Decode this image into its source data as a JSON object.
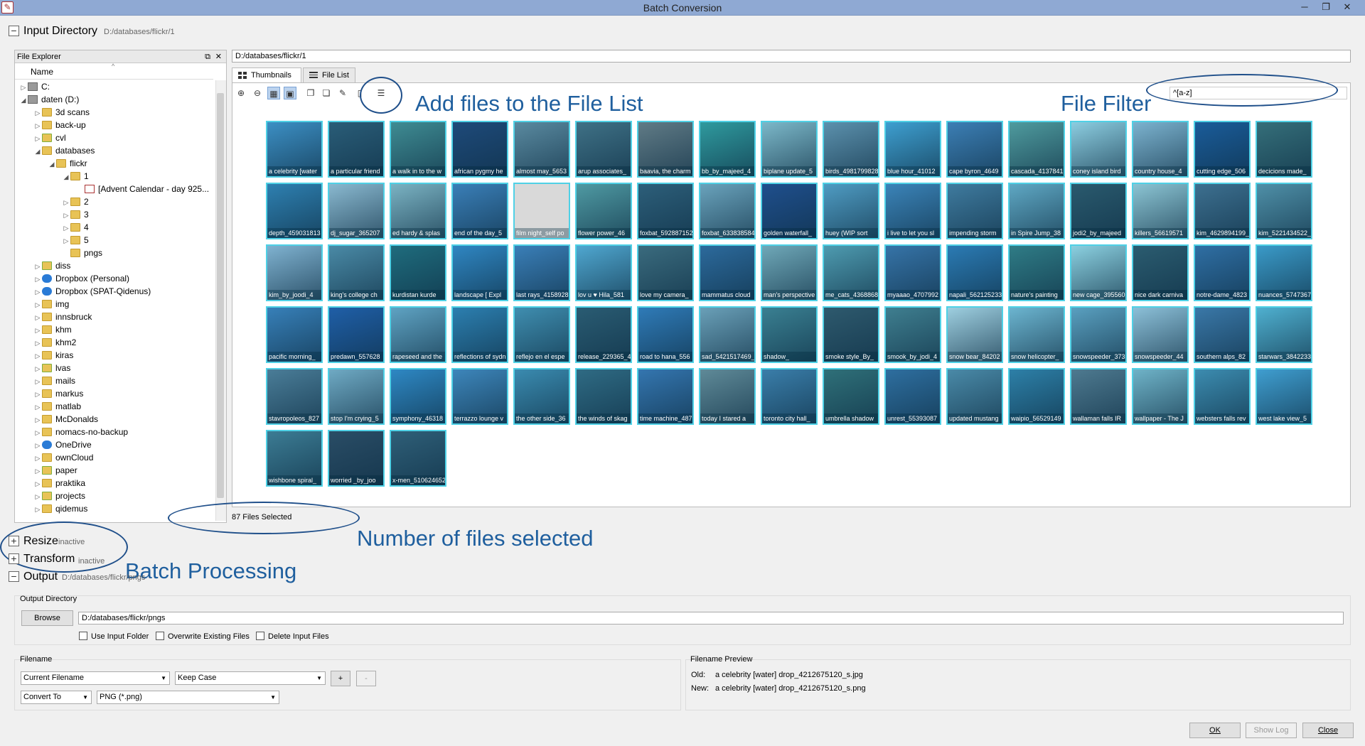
{
  "window": {
    "title": "Batch Conversion",
    "icon": "app-icon"
  },
  "input": {
    "heading": "Input Directory",
    "path": "D:/databases/flickr/1",
    "path_field": "D:/databases/flickr/1"
  },
  "explorer": {
    "title": "File Explorer",
    "column": "Name",
    "items": [
      {
        "label": "C:",
        "arrow": "▷",
        "icon": "drive",
        "depth": 0
      },
      {
        "label": "daten (D:)",
        "arrow": "◢",
        "icon": "drive",
        "depth": 0
      },
      {
        "label": "3d scans",
        "arrow": "▷",
        "icon": "folder",
        "depth": 1
      },
      {
        "label": "back-up",
        "arrow": "▷",
        "icon": "folder",
        "depth": 1
      },
      {
        "label": "cvl",
        "arrow": "▷",
        "icon": "folder-green",
        "depth": 1
      },
      {
        "label": "databases",
        "arrow": "◢",
        "icon": "folder",
        "depth": 1
      },
      {
        "label": "flickr",
        "arrow": "◢",
        "icon": "folder",
        "depth": 2
      },
      {
        "label": "1",
        "arrow": "◢",
        "icon": "folder",
        "depth": 3
      },
      {
        "label": "[Advent Calendar - day 925...",
        "arrow": "",
        "icon": "imgfile",
        "depth": 4
      },
      {
        "label": "2",
        "arrow": "▷",
        "icon": "folder",
        "depth": 3
      },
      {
        "label": "3",
        "arrow": "▷",
        "icon": "folder",
        "depth": 3
      },
      {
        "label": "4",
        "arrow": "▷",
        "icon": "folder",
        "depth": 3
      },
      {
        "label": "5",
        "arrow": "▷",
        "icon": "folder",
        "depth": 3
      },
      {
        "label": "pngs",
        "arrow": "",
        "icon": "folder",
        "depth": 3
      },
      {
        "label": "diss",
        "arrow": "▷",
        "icon": "folder-green",
        "depth": 1
      },
      {
        "label": "Dropbox (Personal)",
        "arrow": "▷",
        "icon": "cloud",
        "depth": 1
      },
      {
        "label": "Dropbox (SPAT-Qidenus)",
        "arrow": "▷",
        "icon": "cloud",
        "depth": 1
      },
      {
        "label": "img",
        "arrow": "▷",
        "icon": "folder",
        "depth": 1
      },
      {
        "label": "innsbruck",
        "arrow": "▷",
        "icon": "folder",
        "depth": 1
      },
      {
        "label": "khm",
        "arrow": "▷",
        "icon": "folder",
        "depth": 1
      },
      {
        "label": "khm2",
        "arrow": "▷",
        "icon": "folder",
        "depth": 1
      },
      {
        "label": "kiras",
        "arrow": "▷",
        "icon": "folder",
        "depth": 1
      },
      {
        "label": "lvas",
        "arrow": "▷",
        "icon": "folder-green",
        "depth": 1
      },
      {
        "label": "mails",
        "arrow": "▷",
        "icon": "folder",
        "depth": 1
      },
      {
        "label": "markus",
        "arrow": "▷",
        "icon": "folder",
        "depth": 1
      },
      {
        "label": "matlab",
        "arrow": "▷",
        "icon": "folder",
        "depth": 1
      },
      {
        "label": "McDonalds",
        "arrow": "▷",
        "icon": "folder",
        "depth": 1
      },
      {
        "label": "nomacs-no-backup",
        "arrow": "▷",
        "icon": "folder",
        "depth": 1
      },
      {
        "label": "OneDrive",
        "arrow": "▷",
        "icon": "cloud",
        "depth": 1
      },
      {
        "label": "ownCloud",
        "arrow": "▷",
        "icon": "folder",
        "depth": 1
      },
      {
        "label": "paper",
        "arrow": "▷",
        "icon": "folder-green",
        "depth": 1
      },
      {
        "label": "praktika",
        "arrow": "▷",
        "icon": "folder",
        "depth": 1
      },
      {
        "label": "projects",
        "arrow": "▷",
        "icon": "folder-green",
        "depth": 1
      },
      {
        "label": "qidemus",
        "arrow": "▷",
        "icon": "folder",
        "depth": 1
      }
    ]
  },
  "tabs": [
    {
      "label": "Thumbnails",
      "icon": "grid-icon"
    },
    {
      "label": "File List",
      "icon": "list-icon"
    }
  ],
  "toolbar": {
    "icons": [
      "zoom-in-icon",
      "zoom-out-icon",
      "grid-small-icon",
      "grid-large-icon",
      "copy-icon",
      "paste-icon",
      "rename-icon",
      "delete-icon",
      "list-add-icon"
    ]
  },
  "filter": {
    "value": "^[a-z]"
  },
  "thumbnails": [
    {
      "c": "a celebrity [water",
      "col": "#3c8fc4"
    },
    {
      "c": "a particular friend",
      "col": "#2a5d78"
    },
    {
      "c": "a walk in to the w",
      "col": "#3f8c93"
    },
    {
      "c": "african pygmy he",
      "col": "#1e4a7a"
    },
    {
      "c": "almost may_5653",
      "col": "#5a8aa0"
    },
    {
      "c": "arup associates_",
      "col": "#3f7186"
    },
    {
      "c": "baavia, the charm",
      "col": "#607b86"
    },
    {
      "c": "bb_by_majeed_4",
      "col": "#2f9a9e"
    },
    {
      "c": "biplane update_5",
      "col": "#7cb8c9"
    },
    {
      "c": "birds_4981799828",
      "col": "#5c91ad"
    },
    {
      "c": "blue hour_41012",
      "col": "#3e9fd0"
    },
    {
      "c": "cape byron_4649",
      "col": "#3c7fb5"
    },
    {
      "c": "cascada_4137841",
      "col": "#4f9b9e"
    },
    {
      "c": "coney island bird",
      "col": "#8ccde0"
    },
    {
      "c": "country house_4",
      "col": "#7cb3cf"
    },
    {
      "c": "cutting edge_506",
      "col": "#1a5c9a"
    },
    {
      "c": "decicions made_",
      "col": "#356f7a"
    },
    {
      "c": "depth_459031813",
      "col": "#2e80b1"
    },
    {
      "c": "dj_sugar_365207",
      "col": "#8ab9d0"
    },
    {
      "c": "ed hardy & splas",
      "col": "#7bb3c3"
    },
    {
      "c": "end of the day_5",
      "col": "#3a7fb8"
    },
    {
      "c": "film night_self po",
      "col": "#d9d9d9"
    },
    {
      "c": "flower power_46",
      "col": "#4f9aa3"
    },
    {
      "c": "foxbat_592887152",
      "col": "#2d5f7a"
    },
    {
      "c": "foxbat_633838584",
      "col": "#6aa3bc"
    },
    {
      "c": "golden waterfall_",
      "col": "#1f4f8d"
    },
    {
      "c": "huey (WIP sort",
      "col": "#4f9cc3"
    },
    {
      "c": "i live to let you sl",
      "col": "#3b84b9"
    },
    {
      "c": "impending storm",
      "col": "#3f7b9f"
    },
    {
      "c": "in Spire Jump_38",
      "col": "#5fa8c4"
    },
    {
      "c": "jodi2_by_majeed",
      "col": "#2a5a6e"
    },
    {
      "c": "killers_56619571",
      "col": "#8cc5d4"
    },
    {
      "c": "kim_4629894199_",
      "col": "#3d7090"
    },
    {
      "c": "kim_5221434522_",
      "col": "#4f90a8"
    },
    {
      "c": "kim_by_joodi_4",
      "col": "#7fb2d0"
    },
    {
      "c": "king's college ch",
      "col": "#4a8aa6"
    },
    {
      "c": "kurdistan kurde",
      "col": "#1f6c7d"
    },
    {
      "c": "landscape [ Expl",
      "col": "#2f86c2"
    },
    {
      "c": "last rays_4158928",
      "col": "#3a7fb8"
    },
    {
      "c": "lov u ♥ Hila_581",
      "col": "#4fa7d0"
    },
    {
      "c": "love my camera_",
      "col": "#3a6b7e"
    },
    {
      "c": "mammatus cloud",
      "col": "#2c6a9c"
    },
    {
      "c": "man's perspective",
      "col": "#6fa8b8"
    },
    {
      "c": "me_cats_4368868",
      "col": "#4e9bb0"
    },
    {
      "c": "myaaao_4707992",
      "col": "#3674a8"
    },
    {
      "c": "napali_562125233",
      "col": "#2b7bb4"
    },
    {
      "c": "nature's painting",
      "col": "#2f7c86"
    },
    {
      "c": "new cage_395560",
      "col": "#8bd0e0"
    },
    {
      "c": "nice dark carniva",
      "col": "#2b5c70"
    },
    {
      "c": "notre-dame_4823",
      "col": "#2f6fa4"
    },
    {
      "c": "nuances_5747367",
      "col": "#3a9ac8"
    },
    {
      "c": "pacific morning_",
      "col": "#3780b9"
    },
    {
      "c": "predawn_557628",
      "col": "#1f5fa8"
    },
    {
      "c": "rapeseed and the",
      "col": "#5fa3c3"
    },
    {
      "c": "reflections of sydn",
      "col": "#2c7fb0"
    },
    {
      "c": "reflejo en el espe",
      "col": "#3f8eb0"
    },
    {
      "c": "release_229365_4",
      "col": "#2a5c73"
    },
    {
      "c": "road to hana_556",
      "col": "#2f7bb8"
    },
    {
      "c": "sad_5421517469_",
      "col": "#6aa0b8"
    },
    {
      "c": "shadow_",
      "col": "#3a8092"
    },
    {
      "c": "smoke style_By_",
      "col": "#2e5a6e"
    },
    {
      "c": "smook_by_jodi_4",
      "col": "#3f7f90"
    },
    {
      "c": "snow bear_84202",
      "col": "#9ecfe0"
    },
    {
      "c": "snow helicopter_",
      "col": "#6cb5d0"
    },
    {
      "c": "snowspeeder_373",
      "col": "#5aa0c0"
    },
    {
      "c": "snowspeeder_44",
      "col": "#8cc0d8"
    },
    {
      "c": "southern alps_82",
      "col": "#3a78a8"
    },
    {
      "c": "starwars_3842233",
      "col": "#4fb0d0"
    },
    {
      "c": "stavropoleos_827",
      "col": "#4a7d98"
    },
    {
      "c": "stop I'm crying_5",
      "col": "#6faac4"
    },
    {
      "c": "symphony_46318",
      "col": "#2e88c4"
    },
    {
      "c": "terrazzo lounge v",
      "col": "#3d86bb"
    },
    {
      "c": "the other side_36",
      "col": "#3a8bb0"
    },
    {
      "c": "the winds of skag",
      "col": "#2f6b84"
    },
    {
      "c": "time machine_487",
      "col": "#3476b0"
    },
    {
      "c": "today I stared a",
      "col": "#5f8a98"
    },
    {
      "c": "toronto city hall_",
      "col": "#3a7eaa"
    },
    {
      "c": "umbrella shadow",
      "col": "#2f7079"
    },
    {
      "c": "unrest_55393087",
      "col": "#2e6fa0"
    },
    {
      "c": "updated mustang",
      "col": "#4a8aa8"
    },
    {
      "c": "waipio_56529149",
      "col": "#2d80a8"
    },
    {
      "c": "wallaman falls IR",
      "col": "#4e7a90"
    },
    {
      "c": "wallpaper - The J",
      "col": "#6fb3c8"
    },
    {
      "c": "websters falls rev",
      "col": "#3c8cb0"
    },
    {
      "c": "west lake view_5",
      "col": "#3f9ed0"
    },
    {
      "c": "wishbone spiral_",
      "col": "#3c7c94"
    },
    {
      "c": "worried _by_joo",
      "col": "#2a4d66"
    },
    {
      "c": "x-men_510624652",
      "col": "#2f5f78"
    }
  ],
  "annotations": {
    "add_files": "Add files to the File List",
    "file_filter": "File Filter",
    "number_selected": "Number of files selected",
    "batch_processing": "Batch Processing"
  },
  "status": {
    "selected": "87 Files Selected"
  },
  "sections": {
    "resize": {
      "label": "Resize",
      "state": "inactive"
    },
    "transform": {
      "label": "Transform",
      "state": "inactive"
    },
    "output": {
      "label": "Output",
      "path": "D:/databases/flickr/pngs"
    }
  },
  "output": {
    "group_label": "Output Directory",
    "browse": "Browse",
    "dir": "D:/databases/flickr/pngs",
    "use_input_folder": "Use Input Folder",
    "overwrite": "Overwrite Existing Files",
    "delete_input": "Delete Input Files"
  },
  "filename": {
    "group_label": "Filename",
    "combo1": "Current Filename",
    "combo2": "Keep Case",
    "plus": "+",
    "minus": "-",
    "combo3": "Convert To",
    "combo4": "PNG (*.png)"
  },
  "preview": {
    "group_label": "Filename Preview",
    "old_label": "Old:",
    "old_value": "a celebrity [water] drop_4212675120_s.jpg",
    "new_label": "New:",
    "new_value": "a celebrity [water] drop_4212675120_s.png"
  },
  "buttons": {
    "ok": "OK",
    "show_log": "Show Log",
    "close": "Close"
  }
}
